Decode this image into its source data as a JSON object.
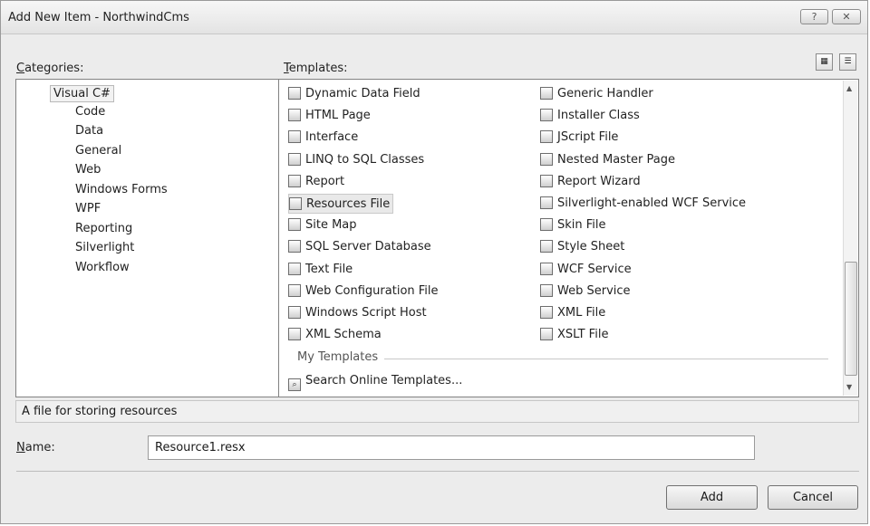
{
  "window": {
    "title": "Add New Item - NorthwindCms",
    "help_label": "?",
    "close_label": "✕"
  },
  "categories": {
    "label_prefix": "",
    "label_hotkey": "C",
    "label_rest": "ategories:",
    "items": [
      "Visual C#",
      "Code",
      "Data",
      "General",
      "Web",
      "Windows Forms",
      "WPF",
      "Reporting",
      "Silverlight",
      "Workflow"
    ],
    "selected": "Visual C#"
  },
  "templates": {
    "label_hotkey": "T",
    "label_rest": "emplates:",
    "left_column": [
      {
        "label": "Dynamic Data Field",
        "icon": "dynamic-data-icon"
      },
      {
        "label": "HTML Page",
        "icon": "html-page-icon"
      },
      {
        "label": "Interface",
        "icon": "interface-icon"
      },
      {
        "label": "LINQ to SQL Classes",
        "icon": "linq-icon"
      },
      {
        "label": "Report",
        "icon": "report-icon"
      },
      {
        "label": "Resources File",
        "icon": "resources-file-icon",
        "selected": true
      },
      {
        "label": "Site Map",
        "icon": "site-map-icon"
      },
      {
        "label": "SQL Server Database",
        "icon": "database-icon"
      },
      {
        "label": "Text File",
        "icon": "text-file-icon"
      },
      {
        "label": "Web Configuration File",
        "icon": "web-config-icon"
      },
      {
        "label": "Windows Script Host",
        "icon": "script-host-icon"
      },
      {
        "label": "XML Schema",
        "icon": "xml-schema-icon"
      }
    ],
    "right_column": [
      {
        "label": "Generic Handler",
        "icon": "generic-handler-icon"
      },
      {
        "label": "Installer Class",
        "icon": "installer-class-icon"
      },
      {
        "label": "JScript File",
        "icon": "jscript-file-icon"
      },
      {
        "label": "Nested Master Page",
        "icon": "nested-master-page-icon"
      },
      {
        "label": "Report Wizard",
        "icon": "report-wizard-icon"
      },
      {
        "label": "Silverlight-enabled WCF Service",
        "icon": "silverlight-wcf-icon"
      },
      {
        "label": "Skin File",
        "icon": "skin-file-icon"
      },
      {
        "label": "Style Sheet",
        "icon": "style-sheet-icon"
      },
      {
        "label": "WCF Service",
        "icon": "wcf-service-icon"
      },
      {
        "label": "Web Service",
        "icon": "web-service-icon"
      },
      {
        "label": "XML File",
        "icon": "xml-file-icon"
      },
      {
        "label": "XSLT File",
        "icon": "xslt-file-icon"
      }
    ],
    "my_templates_header": "My Templates",
    "search_online": "Search Online Templates..."
  },
  "description": "A file for storing resources",
  "name_field": {
    "label_hotkey": "N",
    "label_rest": "ame:",
    "value": "Resource1.resx"
  },
  "buttons": {
    "add": "Add",
    "cancel": "Cancel"
  }
}
